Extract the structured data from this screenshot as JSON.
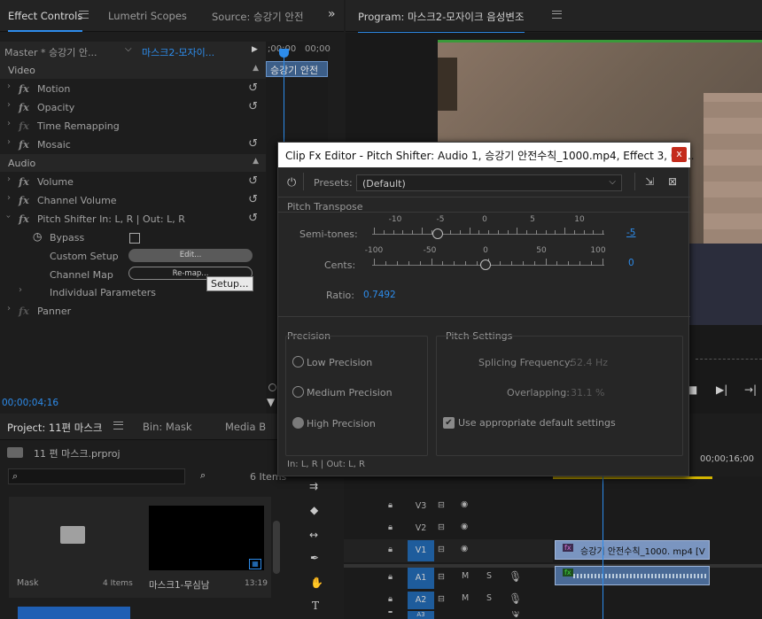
{
  "colors": {
    "accent": "#2d8ceb",
    "panel": "#1d1d1d",
    "modal": "#262626"
  },
  "effect_controls": {
    "tabs": [
      "Effect Controls",
      "Lumetri Scopes",
      "Source: 승강기 안전"
    ],
    "more": "»",
    "master_label": "Master * 승강기 안...",
    "clip_label": "마스크2-모자이...",
    "timecode_left": ";00;00",
    "timecode_right": "00;00",
    "clip_bar": "승강기 안전",
    "video_header": "Video",
    "audio_header": "Audio",
    "items": {
      "motion": "Motion",
      "opacity": "Opacity",
      "time_remap": "Time Remapping",
      "mosaic": "Mosaic",
      "volume": "Volume",
      "channel_volume": "Channel Volume",
      "pitch_shifter": "Pitch Shifter In: L, R | Out: L, R",
      "bypass": "Bypass",
      "custom_setup": "Custom Setup",
      "channel_map": "Channel Map",
      "individual": "Individual Parameters",
      "panner": "Panner"
    },
    "edit_button": "Edit...",
    "remap_button": "Re-map...",
    "setup_tooltip": "Setup...",
    "current_time": "00;00;04;16"
  },
  "program": {
    "title": "Program: 마스크2-모자이크 음성변조",
    "right_time": "00;00;16;00"
  },
  "project": {
    "tabs": [
      "Project: 11편 마스크",
      "Bin: Mask",
      "Media B"
    ],
    "project_file": "11 편 마스크.prproj",
    "search_placeholder": "",
    "item_count": "6 Items",
    "bins": [
      {
        "name": "Mask",
        "meta": "4 Items"
      },
      {
        "name": "마스크1-무심남",
        "meta": "13:19"
      }
    ]
  },
  "modal": {
    "title": "Clip Fx Editor - Pitch Shifter: Audio 1, 승강기 안전수칙_1000.mp4, Effect 3, 00...",
    "close": "x",
    "presets_label": "Presets:",
    "preset_value": "(Default)",
    "pitch_transpose": "Pitch Transpose",
    "semitones_label": "Semi-tones:",
    "semitones_ticks": [
      "-10",
      "-5",
      "0",
      "5",
      "10"
    ],
    "semitones_value": "-5",
    "cents_label": "Cents:",
    "cents_ticks": [
      "-100",
      "-50",
      "0",
      "50",
      "100"
    ],
    "cents_value": "0",
    "ratio_label": "Ratio:",
    "ratio_value": "0.7492",
    "precision_title": "Precision",
    "precision_options": [
      "Low Precision",
      "Medium Precision",
      "High Precision"
    ],
    "precision_selected": "High Precision",
    "pitch_settings_title": "Pitch Settings",
    "splicing_label": "Splicing Frequency:",
    "splicing_value": "52.4 Hz",
    "overlapping_label": "Overlapping:",
    "overlapping_value": "31.1 %",
    "default_settings_label": "Use appropriate default settings",
    "io_label": "In: L, R | Out: L, R"
  },
  "timeline": {
    "tracks": [
      {
        "name": "V3",
        "type": "video"
      },
      {
        "name": "V2",
        "type": "video"
      },
      {
        "name": "V1",
        "type": "video"
      },
      {
        "name": "A1",
        "type": "audio"
      },
      {
        "name": "A2",
        "type": "audio"
      },
      {
        "name": "A3",
        "type": "audio"
      }
    ],
    "video_clip": "승강기 안전수칙_1000. mp4 [V",
    "mute": "M",
    "solo": "S"
  }
}
